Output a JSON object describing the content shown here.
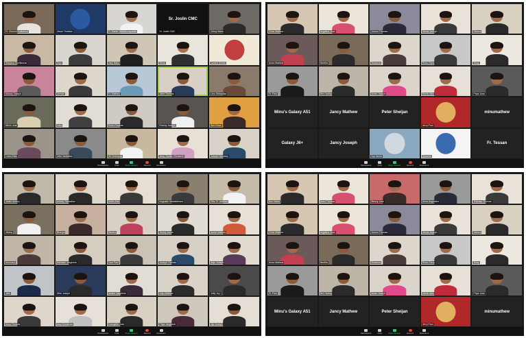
{
  "screenshots": [
    {
      "toolbar": [
        "Participants",
        "Chat",
        "Share Screen",
        "Record",
        "Reactions"
      ],
      "tiles": [
        {
          "name": "Fr. Vincent Kallumkal",
          "bg": "#7c6a58",
          "shirt": "#e8e4dc",
          "skin": "#8a5a3a"
        },
        {
          "name": "Jesse Thottam",
          "bg": "#1f3a66",
          "shirt": "",
          "skin": "",
          "logo": "#2a5aa0"
        },
        {
          "name": "Fr. Martin Vadakkumpadan",
          "bg": "#d8d6d2",
          "shirt": "#f2f2f2",
          "skin": "#9b6b4a"
        },
        {
          "name": "Sr. Joslin CMC",
          "bg": "#111111",
          "shirt": "",
          "skin": "",
          "text": "Sr. Joslin CMC"
        },
        {
          "name": "Johny Manu",
          "bg": "#6d6a66",
          "shirt": "#2b2b2b",
          "skin": "#a06a4a"
        },
        {
          "name": "Sanjana Sunilkumar",
          "bg": "#c9b9a4",
          "shirt": "#3a2a3a",
          "skin": "#8a5a3a"
        },
        {
          "name": "Jisjo",
          "bg": "#d9d6cf",
          "shirt": "#3c3c3c",
          "skin": "#8c5a3c"
        },
        {
          "name": "Joby Babu",
          "bg": "#cfc6b6",
          "shirt": "#1f1f1f",
          "skin": "#9b6b4a"
        },
        {
          "name": "Neha",
          "bg": "#e9e4dc",
          "shirt": "#2f2f2f",
          "skin": "#a7734f"
        },
        {
          "name": "Lumen Christi",
          "bg": "#f0e9d8",
          "shirt": "",
          "skin": "",
          "logo": "#c04040"
        },
        {
          "name": "Antony Joseph",
          "bg": "#c8849a",
          "shirt": "#5a5a5a",
          "skin": "#8a5a3a"
        },
        {
          "name": "Jeevan",
          "bg": "#ded8cc",
          "shirt": "#3a3a3a",
          "skin": "#9b6b4a"
        },
        {
          "name": "Fr. Mathew",
          "bg": "#b9c8d6",
          "shirt": "#6a9ab6",
          "skin": "#8a5a3a"
        },
        {
          "name": "Jane Thomas",
          "bg": "#d8d0c4",
          "shirt": "#2a3a5a",
          "skin": "#8a5a3a",
          "sel": true
        },
        {
          "name": "Linu Sebastian",
          "bg": "#8a7a6a",
          "shirt": "#6a4a3a",
          "skin": "#8a5a3a"
        },
        {
          "name": "Merin Jose",
          "bg": "#6a6a5a",
          "shirt": "#d8d0b0",
          "skin": "#8a5a3a"
        },
        {
          "name": "Joby",
          "bg": "#e2ddd4",
          "shirt": "#404040",
          "skin": "#9b6b4a"
        },
        {
          "name": "Sebin Paulose",
          "bg": "#cfcbc4",
          "shirt": "#2a2a2a",
          "skin": "#8a5a3a"
        },
        {
          "name": "Rosmy Joseph",
          "bg": "#5a5450",
          "shirt": "#f0f0f0",
          "skin": "#8a5a3a"
        },
        {
          "name": "Ann Rose",
          "bg": "#e0a040",
          "shirt": "#3a2a2a",
          "skin": "#a06a4a"
        },
        {
          "name": "Linea Elias",
          "bg": "#9a948a",
          "shirt": "#6a4a5a",
          "skin": "#8a5a3a"
        },
        {
          "name": "Jolin Vadakkan",
          "bg": "#8a8a8a",
          "shirt": "#3a4a5a",
          "skin": "#8a5a3a"
        },
        {
          "name": "Gil Chempan",
          "bg": "#c8b8a0",
          "shirt": "#f2f2f2",
          "skin": "#8a5a3a"
        },
        {
          "name": "Jeny, Daniel, Elizabeth",
          "bg": "#e8e0d4",
          "shirt": "#d0a0c0",
          "skin": "#a06a4a"
        },
        {
          "name": "Joseph Devassy",
          "bg": "#d8d2c8",
          "shirt": "#2a4a6a",
          "skin": "#8a5a3a"
        }
      ]
    },
    {
      "toolbar": [
        "Participants",
        "Chat",
        "Share Screen",
        "Record",
        "Reactions"
      ],
      "tiles": [
        {
          "name": "Chris Mathew",
          "bg": "#d6c7b2",
          "shirt": "#2a2a2a",
          "skin": "#9b6b4a"
        },
        {
          "name": "Angelina Jose",
          "bg": "#ece6da",
          "shirt": "#d85070",
          "skin": "#a06a4a"
        },
        {
          "name": "Jomon Thomas",
          "bg": "#8a8a9a",
          "shirt": "#2a2a3a",
          "skin": "#8a5a3a"
        },
        {
          "name": "Jenna Joseph",
          "bg": "#e8e2d8",
          "shirt": "#3a3a3a",
          "skin": "#a06a4a"
        },
        {
          "name": "Aleena",
          "bg": "#d8d0c0",
          "shirt": "#2a2a2a",
          "skin": "#9b6b4a"
        },
        {
          "name": "Anna Mathew",
          "bg": "#6a5a5a",
          "shirt": "#c04050",
          "skin": "#a06a4a"
        },
        {
          "name": "Neetha",
          "bg": "#7a6a5a",
          "shirt": "#2a2a2a",
          "skin": "#8a5a3a"
        },
        {
          "name": "Susanna",
          "bg": "#dcd6cc",
          "shirt": "#4a3a3a",
          "skin": "#9b6b4a"
        },
        {
          "name": "Rinku Tomy",
          "bg": "#c8c8c8",
          "shirt": "#3a3a3a",
          "skin": "#9b6b4a"
        },
        {
          "name": "Jinny",
          "bg": "#ece8e0",
          "shirt": "#2a2a2a",
          "skin": "#a06a4a"
        },
        {
          "name": "Fr. Paul",
          "bg": "#9a9a9a",
          "shirt": "#1a1a1a",
          "skin": "#8a5a3a"
        },
        {
          "name": "Ben Varkey",
          "bg": "#bdb5a8",
          "shirt": "#2a2a2a",
          "skin": "#8a5a3a"
        },
        {
          "name": "Annie Joseph",
          "bg": "#dad4ca",
          "shirt": "#e04a8a",
          "skin": "#a06a4a"
        },
        {
          "name": "Merlin Alex",
          "bg": "#e6e0d6",
          "shirt": "#c02a3a",
          "skin": "#9b6b4a"
        },
        {
          "name": "Priya Jose",
          "bg": "#5a5a5a",
          "shirt": "#2a2a2a",
          "skin": "#a06a4a"
        },
        {
          "name": "",
          "bg": "#222222",
          "shirt": "",
          "skin": "",
          "text": "Minu's Galaxy A51"
        },
        {
          "name": "",
          "bg": "#222222",
          "shirt": "",
          "skin": "",
          "text": "Jancy Mathew"
        },
        {
          "name": "",
          "bg": "#222222",
          "shirt": "",
          "skin": "",
          "text": "Peter Sheijan"
        },
        {
          "name": "Jerry Paul",
          "bg": "#b0282a",
          "shirt": "",
          "skin": "",
          "logo": "#e0b060"
        },
        {
          "name": "",
          "bg": "#222222",
          "shirt": "",
          "skin": "",
          "text": "minumathew"
        },
        {
          "name": "",
          "bg": "#222222",
          "shirt": "",
          "skin": "",
          "text": "Galaxy J6+"
        },
        {
          "name": "",
          "bg": "#222222",
          "shirt": "",
          "skin": "",
          "text": "Jancy Joseph"
        },
        {
          "name": "Joy Jacob",
          "bg": "#8aa8c0",
          "shirt": "",
          "skin": "",
          "logo": "#d0d8e0"
        },
        {
          "name": "Queenie",
          "bg": "#f4f4f4",
          "shirt": "",
          "skin": "",
          "logo": "#3a6ab0"
        },
        {
          "name": "",
          "bg": "#222222",
          "shirt": "",
          "skin": "",
          "text": "Fr. Tessan"
        }
      ]
    },
    {
      "toolbar": [
        "Participants",
        "Chat",
        "Share Screen",
        "Record",
        "Reactions"
      ],
      "tiles": [
        {
          "name": "Jestin Antony",
          "bg": "#c0b8a8",
          "shirt": "#2a2a2a",
          "skin": "#9b6b4a"
        },
        {
          "name": "Ashley Sebastian",
          "bg": "#ddd6ca",
          "shirt": "#2a2a2a",
          "skin": "#a06a4a"
        },
        {
          "name": "Jeslin Anto",
          "bg": "#e6ded2",
          "shirt": "#3a3a3a",
          "skin": "#a06a4a"
        },
        {
          "name": "Augustin Vadakkekara",
          "bg": "#8a8070",
          "shirt": "#3a3a3a",
          "skin": "#8a5a3a"
        },
        {
          "name": "Rev. Fr. Mathew",
          "bg": "#c4bca8",
          "shirt": "#f2f2f2",
          "skin": "#8a5a3a"
        },
        {
          "name": "Jimmy",
          "bg": "#7a7060",
          "shirt": "#f0f0f0",
          "skin": "#8a5a3a"
        },
        {
          "name": "Bhavya",
          "bg": "#c8b0a0",
          "shirt": "#3a2a2a",
          "skin": "#9b6b4a"
        },
        {
          "name": "Martina",
          "bg": "#d8d0c4",
          "shirt": "#c04060",
          "skin": "#a06a4a"
        },
        {
          "name": "Jimmy Jacob",
          "bg": "#e0dcd4",
          "shirt": "#2a2a2a",
          "skin": "#8a5a3a"
        },
        {
          "name": "Annie Mathew",
          "bg": "#e6e0d6",
          "shirt": "#d05a3a",
          "skin": "#a06a4a"
        },
        {
          "name": "Annmary",
          "bg": "#bfb6a8",
          "shirt": "#4a3a3a",
          "skin": "#9b6b4a"
        },
        {
          "name": "Abhilash Varghese",
          "bg": "#d4cdc0",
          "shirt": "#2a2a2a",
          "skin": "#8a5a3a"
        },
        {
          "name": "Jose Paul",
          "bg": "#cac2b4",
          "shirt": "#3a3a3a",
          "skin": "#8a5a3a"
        },
        {
          "name": "Joseph Thomas",
          "bg": "#d6d0c6",
          "shirt": "#2a4a6a",
          "skin": "#9b6b4a"
        },
        {
          "name": "Anju Joseph",
          "bg": "#e0dad0",
          "shirt": "#5a3a5a",
          "skin": "#a06a4a"
        },
        {
          "name": "Jibin",
          "bg": "#c0c4c8",
          "shirt": "#1a2a4a",
          "skin": "#8a5a3a"
        },
        {
          "name": "Jibin Joseph",
          "bg": "#2a3a5a",
          "shirt": "#2a2a2a",
          "skin": "#8a5a3a"
        },
        {
          "name": "Ashika Varghese",
          "bg": "#e2ddd4",
          "shirt": "#3a2a3a",
          "skin": "#a06a4a"
        },
        {
          "name": "Anju Mathew",
          "bg": "#d8d2c8",
          "shirt": "#2a2a2a",
          "skin": "#a06a4a"
        },
        {
          "name": "Jolly Joy",
          "bg": "#4a4a4a",
          "shirt": "#2a2a2a",
          "skin": "#9b6b4a"
        },
        {
          "name": "Ancy Thomas",
          "bg": "#ded6ca",
          "shirt": "#3a3a3a",
          "skin": "#a06a4a"
        },
        {
          "name": "Amy Kuriakose",
          "bg": "#e6e0d8",
          "shirt": "#c0c0c0",
          "skin": "#a06a4a"
        },
        {
          "name": "Evangelin Jose",
          "bg": "#d8d0c2",
          "shirt": "#2a2a2a",
          "skin": "#a06a4a"
        },
        {
          "name": "Priya Varghese",
          "bg": "#cfc8bc",
          "shirt": "#4a2a3a",
          "skin": "#9b6b4a"
        },
        {
          "name": "Jijo Joseph",
          "bg": "#e4ded4",
          "shirt": "#2a2a2a",
          "skin": "#8a5a3a"
        }
      ]
    },
    {
      "toolbar": [
        "Participants",
        "Chat",
        "Share Screen",
        "Record",
        "Reactions"
      ],
      "tiles": [
        {
          "name": "Ann Maria",
          "bg": "#d6c7b2",
          "shirt": "#2a2a2a",
          "skin": "#9b6b4a"
        },
        {
          "name": "Annu Thomas",
          "bg": "#ece6da",
          "shirt": "#d85070",
          "skin": "#a06a4a"
        },
        {
          "name": "Blessy Jose",
          "bg": "#c86a6a",
          "shirt": "#3a2a2a",
          "skin": "#a06a4a"
        },
        {
          "name": "Anna Augustine",
          "bg": "#9a9a9a",
          "shirt": "#2a2a3a",
          "skin": "#8a5a3a"
        },
        {
          "name": "Theresa Thomas",
          "bg": "#e8e2d8",
          "shirt": "#3a3a3a",
          "skin": "#a06a4a"
        },
        {
          "name": "Chris Mathew",
          "bg": "#d6c7b2",
          "shirt": "#2a2a2a",
          "skin": "#9b6b4a"
        },
        {
          "name": "Angelina Jose",
          "bg": "#ece6da",
          "shirt": "#d85070",
          "skin": "#a06a4a"
        },
        {
          "name": "Jomon Thomas",
          "bg": "#8a8a9a",
          "shirt": "#2a2a3a",
          "skin": "#8a5a3a"
        },
        {
          "name": "Jenna Joseph",
          "bg": "#e8e2d8",
          "shirt": "#3a3a3a",
          "skin": "#a06a4a"
        },
        {
          "name": "Aleena",
          "bg": "#d8d0c0",
          "shirt": "#2a2a2a",
          "skin": "#9b6b4a"
        },
        {
          "name": "Anna Mathew",
          "bg": "#6a5a5a",
          "shirt": "#c04050",
          "skin": "#a06a4a"
        },
        {
          "name": "Neetha",
          "bg": "#7a6a5a",
          "shirt": "#2a2a2a",
          "skin": "#8a5a3a"
        },
        {
          "name": "Susanna",
          "bg": "#dcd6cc",
          "shirt": "#4a3a3a",
          "skin": "#9b6b4a"
        },
        {
          "name": "Rinku Tomy",
          "bg": "#c8c8c8",
          "shirt": "#3a3a3a",
          "skin": "#9b6b4a"
        },
        {
          "name": "Jinny",
          "bg": "#ece8e0",
          "shirt": "#2a2a2a",
          "skin": "#a06a4a"
        },
        {
          "name": "Fr. Paul",
          "bg": "#9a9a9a",
          "shirt": "#1a1a1a",
          "skin": "#8a5a3a"
        },
        {
          "name": "Ben Varkey",
          "bg": "#bdb5a8",
          "shirt": "#2a2a2a",
          "skin": "#8a5a3a"
        },
        {
          "name": "Annie Joseph",
          "bg": "#dad4ca",
          "shirt": "#e04a8a",
          "skin": "#a06a4a"
        },
        {
          "name": "Merlin Alex",
          "bg": "#e6e0d6",
          "shirt": "#c02a3a",
          "skin": "#9b6b4a"
        },
        {
          "name": "Priya Jose",
          "bg": "#5a5a5a",
          "shirt": "#2a2a2a",
          "skin": "#a06a4a"
        },
        {
          "name": "",
          "bg": "#222222",
          "shirt": "",
          "skin": "",
          "text": "Minu's Galaxy A51"
        },
        {
          "name": "",
          "bg": "#222222",
          "shirt": "",
          "skin": "",
          "text": "Jancy Mathew"
        },
        {
          "name": "",
          "bg": "#222222",
          "shirt": "",
          "skin": "",
          "text": "Peter Sheijan"
        },
        {
          "name": "Jerry Paul",
          "bg": "#b0282a",
          "shirt": "",
          "skin": "",
          "logo": "#e0b060"
        },
        {
          "name": "",
          "bg": "#222222",
          "shirt": "",
          "skin": "",
          "text": "minumathew"
        }
      ]
    }
  ]
}
